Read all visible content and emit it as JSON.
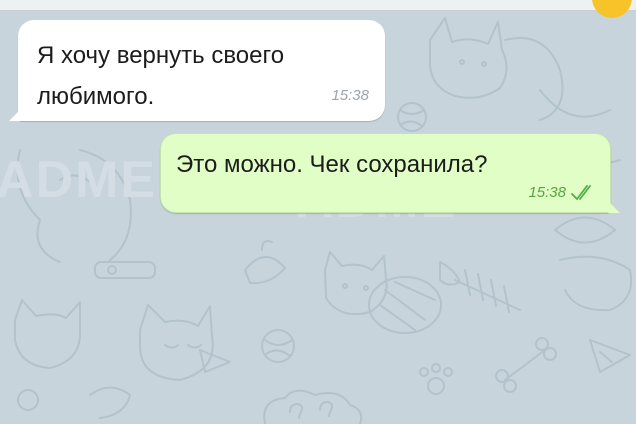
{
  "chat": {
    "messages": [
      {
        "direction": "incoming",
        "text": "Я хочу вернуть своего любимого.",
        "time": "15:38"
      },
      {
        "direction": "outgoing",
        "text": "Это можно. Чек сохранила?",
        "time": "15:38",
        "status_icon": "double-check-icon"
      }
    ],
    "watermark": "ADME"
  },
  "colors": {
    "background": "#c7d4dc",
    "incoming_bubble": "#ffffff",
    "outgoing_bubble": "#e1fec6",
    "read_check": "#4fb142"
  }
}
